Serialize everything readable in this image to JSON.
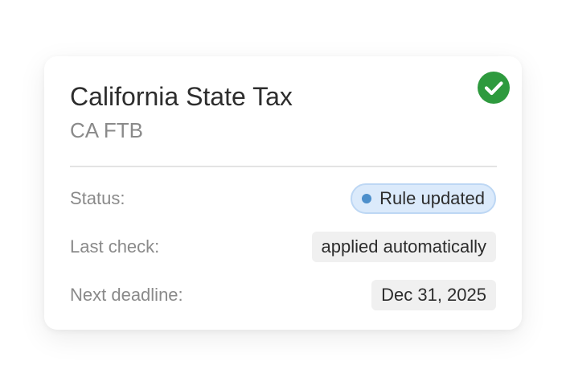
{
  "card": {
    "title": "California State Tax",
    "subtitle": "CA FTB",
    "verified_icon": "check-circle-icon",
    "rows": [
      {
        "label": "Status:",
        "value": "Rule updated"
      },
      {
        "label": "Last check:",
        "value": "applied automatically"
      },
      {
        "label": "Next deadline:",
        "value": "Dec 31, 2025"
      }
    ]
  },
  "colors": {
    "check": "#2e9a3e",
    "status_pill_bg": "#dbeafb",
    "status_pill_border": "#bdd7f4",
    "status_dot": "#4d8fcb",
    "value_pill_bg": "#f0f0f0"
  }
}
